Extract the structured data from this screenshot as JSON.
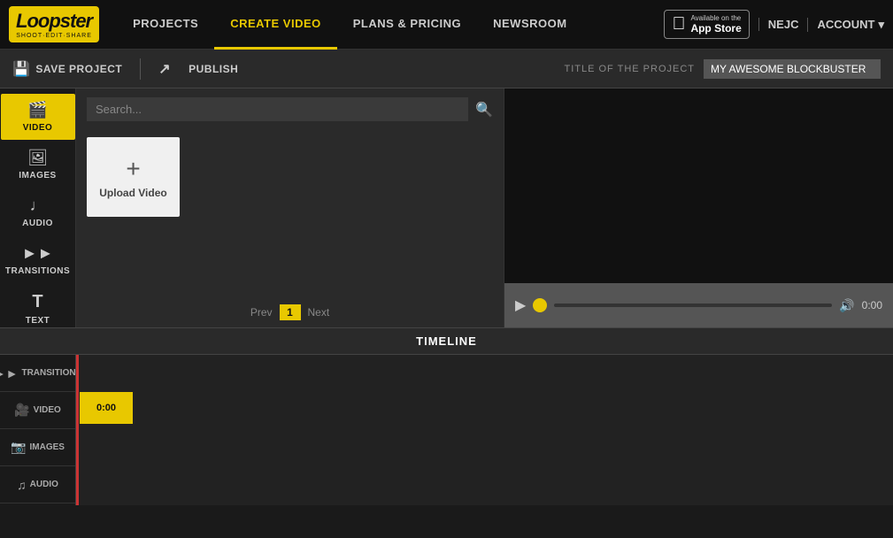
{
  "nav": {
    "logo": "Loopster",
    "logo_sub": "SHOOT·EDIT·SHARE",
    "links": [
      {
        "label": "PROJECTS",
        "active": false
      },
      {
        "label": "CREATE VIDEO",
        "active": true
      },
      {
        "label": "PLANS & PRICING",
        "active": false
      },
      {
        "label": "NEWSROOM",
        "active": false
      }
    ],
    "app_store_small": "Available on the",
    "app_store_big": "App Store",
    "user": "NEJC",
    "account": "ACCOUNT"
  },
  "toolbar": {
    "save_label": "SAVE PROJECT",
    "publish_label": "PUBLISH",
    "title_label": "TITLE OF THE PROJECT",
    "title_value": "MY AWESOME BLOCKBUSTER"
  },
  "sidebar": {
    "items": [
      {
        "id": "video",
        "label": "VIDEO",
        "icon": "🎬",
        "active": true
      },
      {
        "id": "images",
        "label": "IMAGES",
        "icon": "🖼"
      },
      {
        "id": "audio",
        "label": "AUDIO",
        "icon": "🎵"
      },
      {
        "id": "transitions",
        "label": "TRANSITIONS",
        "icon": "⏩"
      },
      {
        "id": "text",
        "label": "TEXT",
        "icon": "T"
      }
    ]
  },
  "search": {
    "placeholder": "Search..."
  },
  "upload": {
    "plus": "+",
    "label": "Upload Video"
  },
  "pagination": {
    "prev": "Prev",
    "page": "1",
    "next": "Next"
  },
  "playback": {
    "time": "0:00"
  },
  "timeline": {
    "title": "TIMELINE",
    "tracks": [
      {
        "icon": "⏩",
        "label": "TRANSITIONS"
      },
      {
        "icon": "🎬",
        "label": "VIDEO"
      },
      {
        "icon": "🖼",
        "label": "IMAGES"
      },
      {
        "icon": "🎵",
        "label": "AUDIO"
      }
    ],
    "block_time": "0:00"
  }
}
